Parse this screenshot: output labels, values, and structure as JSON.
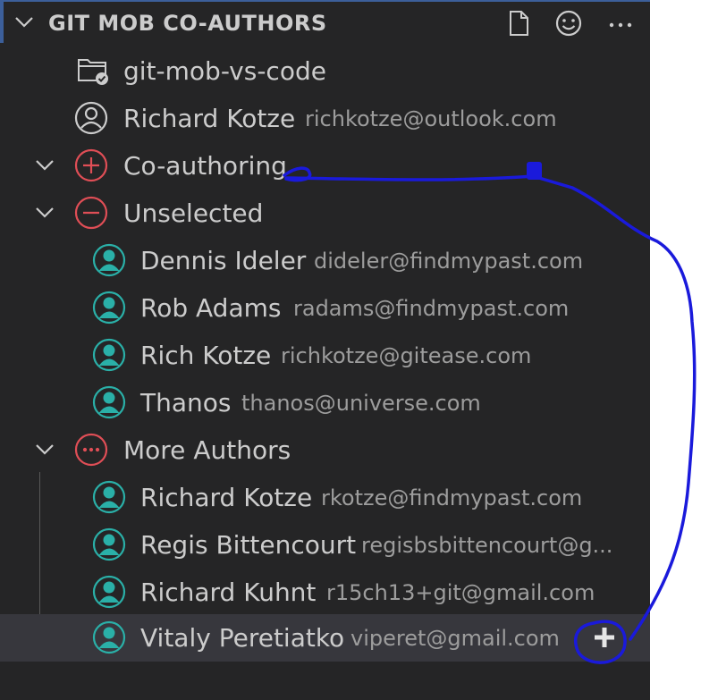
{
  "view": {
    "title": "GIT MOB CO-AUTHORS",
    "actions": [
      "new-file-icon",
      "smiley-icon",
      "ellipsis-icon"
    ]
  },
  "repo": {
    "name": "git-mob-vs-code",
    "icon": "folder-git-icon"
  },
  "user": {
    "name": "Richard Kotze",
    "email": "richkotze@outlook.com",
    "icon": "account-icon"
  },
  "groups": {
    "coauthoring": {
      "label": "Co-authoring",
      "icon": "add-circle-icon"
    },
    "unselected": {
      "label": "Unselected",
      "icon": "remove-circle-icon",
      "authors": [
        {
          "name": "Dennis Ideler",
          "email": "dideler@findmypast.com"
        },
        {
          "name": "Rob Adams",
          "email": "radams@findmypast.com"
        },
        {
          "name": "Rich Kotze",
          "email": "richkotze@gitease.com"
        },
        {
          "name": "Thanos",
          "email": "thanos@universe.com"
        }
      ]
    },
    "more": {
      "label": "More Authors",
      "icon": "more-circle-icon",
      "authors": [
        {
          "name": "Richard Kotze",
          "email": "rkotze@findmypast.com"
        },
        {
          "name": "Regis Bittencourt",
          "email": "regisbsbittencourt@g..."
        },
        {
          "name": "Richard Kuhnt",
          "email": "r15ch13+git@gmail.com"
        },
        {
          "name": "Vitaly Peretiatko",
          "email": "viperet@gmail.com"
        }
      ]
    }
  },
  "colors": {
    "panel_bg": "#252526",
    "text": "#cccccc",
    "muted": "#9d9d9d",
    "accent_red": "#e04e56",
    "avatar_teal": "#2ab0a8",
    "annotation": "#1a1adb"
  }
}
